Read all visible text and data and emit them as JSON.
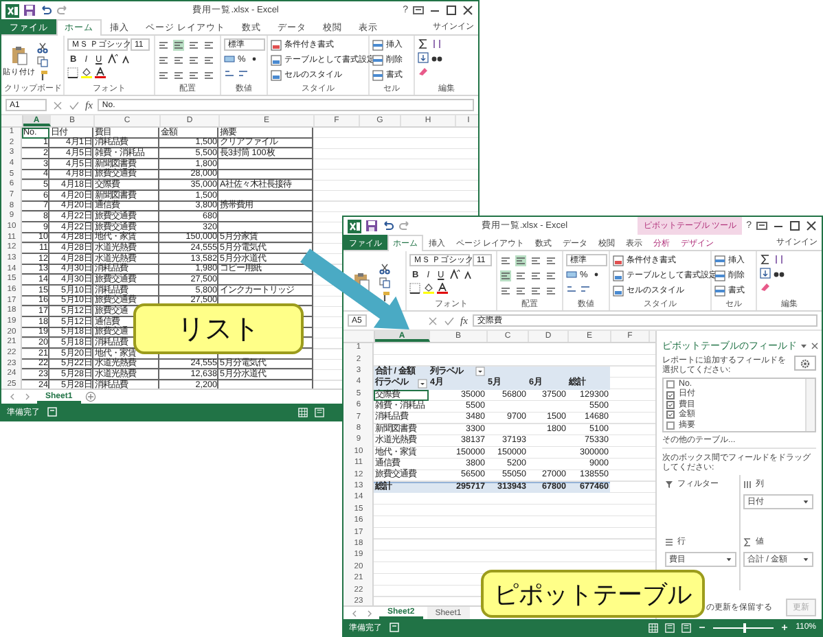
{
  "list_window": {
    "title": "費用一覧.xlsx - Excel",
    "help": "?",
    "file_tab": "ファイル",
    "tabs": [
      {
        "label": "ホーム",
        "selected": true
      },
      {
        "label": "挿入",
        "selected": false
      },
      {
        "label": "ページ レイアウト",
        "selected": false
      },
      {
        "label": "数式",
        "selected": false
      },
      {
        "label": "データ",
        "selected": false
      },
      {
        "label": "校閲",
        "selected": false
      },
      {
        "label": "表示",
        "selected": false
      }
    ],
    "sign_in": "サインイン",
    "ribbon": {
      "paste_label": "貼り付け",
      "font_name": "ＭＳ Ｐゴシック",
      "font_size": "11",
      "format_buttons": [
        "B",
        "I",
        "U"
      ],
      "number_format": "標準",
      "percent": "%",
      "style_commands": [
        "条件付き書式",
        "テーブルとして書式設定",
        "セルのスタイル"
      ],
      "cell_commands": [
        "挿入",
        "削除",
        "書式"
      ],
      "labels": {
        "clipboard": "クリップボード",
        "font": "フォント",
        "alignment": "配置",
        "number": "数値",
        "styles": "スタイル",
        "cells": "セル",
        "editing": "編集"
      }
    },
    "name_box": "A1",
    "fx": "fx",
    "formula": "No.",
    "grid": {
      "kind": "list",
      "columns": [
        "A",
        "B",
        "C",
        "D",
        "E",
        "F",
        "G",
        "H",
        "I"
      ],
      "rows": [
        {
          "num": "1",
          "kind": "header",
          "cells": [
            {
              "text": "No.",
              "active": true
            },
            "日付",
            "費目",
            "金額",
            "摘要"
          ]
        },
        {
          "num": "2",
          "cells": [
            "1",
            "4月1日",
            "消耗品費",
            "1,500",
            "クリアファイル"
          ]
        },
        {
          "num": "3",
          "cells": [
            "2",
            "4月5日",
            "雑費・消耗品",
            "5,500",
            "長3封筒 100枚"
          ]
        },
        {
          "num": "4",
          "cells": [
            "3",
            "4月5日",
            "新聞図書費",
            "1,800"
          ]
        },
        {
          "num": "5",
          "cells": [
            "4",
            "4月8日",
            "旅費交通費",
            "28,000"
          ]
        },
        {
          "num": "6",
          "cells": [
            "5",
            "4月18日",
            "交際費",
            "35,000",
            "A社佐々木社長接待"
          ]
        },
        {
          "num": "7",
          "cells": [
            "6",
            "4月20日",
            "新聞図書費",
            "1,500"
          ]
        },
        {
          "num": "8",
          "cells": [
            "7",
            "4月20日",
            "通信費",
            "3,800",
            "携帯費用"
          ]
        },
        {
          "num": "9",
          "cells": [
            "8",
            "4月22日",
            "旅費交通費",
            "680"
          ]
        },
        {
          "num": "10",
          "cells": [
            "9",
            "4月22日",
            "旅費交通費",
            "320"
          ]
        },
        {
          "num": "11",
          "cells": [
            "10",
            "4月28日",
            "地代・家賃",
            "150,000",
            "5月分家賃"
          ]
        },
        {
          "num": "12",
          "cells": [
            "11",
            "4月28日",
            "水道光熱費",
            "24,555",
            "5月分電気代"
          ]
        },
        {
          "num": "13",
          "cells": [
            "12",
            "4月28日",
            "水道光熱費",
            "13,582",
            "5月分水道代"
          ]
        },
        {
          "num": "14",
          "cells": [
            "13",
            "4月30日",
            "消耗品費",
            "1,980",
            "コピー用紙"
          ]
        },
        {
          "num": "15",
          "cells": [
            "14",
            "4月30日",
            "旅費交通費",
            "27,500"
          ]
        },
        {
          "num": "16",
          "cells": [
            "15",
            "5月10日",
            "消耗品費",
            "5,800",
            "インクカートリッジ"
          ]
        },
        {
          "num": "17",
          "cells": [
            "16",
            "5月10日",
            "旅費交通費",
            "27,500"
          ]
        },
        {
          "num": "18",
          "cells": [
            "17",
            "5月12日",
            "旅費交通"
          ]
        },
        {
          "num": "19",
          "cells": [
            "18",
            "5月12日",
            "通信費"
          ]
        },
        {
          "num": "20",
          "cells": [
            "19",
            "5月18日",
            "旅費交通"
          ]
        },
        {
          "num": "21",
          "cells": [
            "20",
            "5月18日",
            "消耗品費"
          ]
        },
        {
          "num": "22",
          "cells": [
            "21",
            "5月20日",
            "地代・家賃"
          ]
        },
        {
          "num": "23",
          "cells": [
            "22",
            "5月22日",
            "水道光熱費",
            "24,555",
            "5月分電気代"
          ]
        },
        {
          "num": "24",
          "cells": [
            "23",
            "5月28日",
            "水道光熱費",
            "12,638",
            "5月分水道代"
          ]
        },
        {
          "num": "25",
          "cells": [
            "24",
            "5月28日",
            "消耗品費",
            "2,200"
          ]
        }
      ]
    },
    "sheet_tabs": [
      {
        "name": "Sheet1",
        "selected": true
      }
    ],
    "status": "準備完了"
  },
  "pivot_window": {
    "title": "費用一覧.xlsx - Excel",
    "help": "?",
    "file_tab": "ファイル",
    "tabs": [
      {
        "label": "ホーム",
        "selected": true
      },
      {
        "label": "挿入",
        "selected": false
      },
      {
        "label": "ページ レイアウト",
        "selected": false
      },
      {
        "label": "数式",
        "selected": false
      },
      {
        "label": "データ",
        "selected": false
      },
      {
        "label": "校閲",
        "selected": false
      },
      {
        "label": "表示",
        "selected": false
      }
    ],
    "context": {
      "label": "ピボットテーブル ツール",
      "tabs": [
        {
          "label": "分析",
          "selected": false
        },
        {
          "label": "デザイン",
          "selected": false
        }
      ]
    },
    "sign_in": "サインイン",
    "ribbon": {
      "font_name": "ＭＳ Ｐゴシック",
      "font_size": "11",
      "format_buttons": [
        "B",
        "I",
        "U"
      ],
      "number_format": "標準",
      "percent": "%",
      "style_commands": [
        "条件付き書式",
        "テーブルとして書式設定",
        "セルのスタイル"
      ],
      "cell_commands": [
        "挿入",
        "削除",
        "書式"
      ],
      "labels": {
        "font": "フォント",
        "alignment": "配置",
        "number": "数値",
        "styles": "スタイル",
        "cells": "セル",
        "editing": "編集"
      }
    },
    "name_box": "A5",
    "fx": "fx",
    "formula": "交際費",
    "grid": {
      "kind": "pivot",
      "columns": [
        "A",
        "B",
        "C",
        "D",
        "E",
        "F"
      ],
      "rows": [
        {
          "num": "1",
          "cells": []
        },
        {
          "num": "2",
          "cells": []
        },
        {
          "num": "3",
          "kind": "head",
          "cells": [
            "合計 / 金額",
            {
              "text": "列ラベル",
              "dropdown": true
            }
          ]
        },
        {
          "num": "4",
          "kind": "head",
          "cells": [
            {
              "text": "行ラベル",
              "dropdown": true
            },
            "4月",
            "5月",
            "6月",
            "総計"
          ]
        },
        {
          "num": "5",
          "kind": "item",
          "cells": [
            {
              "text": "交際費",
              "active": true
            },
            "35000",
            "56800",
            "37500",
            "129300"
          ]
        },
        {
          "num": "6",
          "kind": "item",
          "cells": [
            "雑費・消耗品",
            "5500",
            null,
            null,
            "5500"
          ]
        },
        {
          "num": "7",
          "kind": "item",
          "cells": [
            "消耗品費",
            "3480",
            "9700",
            "1500",
            "14680"
          ]
        },
        {
          "num": "8",
          "kind": "item",
          "cells": [
            "新聞図書費",
            "3300",
            null,
            "1800",
            "5100"
          ]
        },
        {
          "num": "9",
          "kind": "item",
          "cells": [
            "水道光熱費",
            "38137",
            "37193",
            null,
            "75330"
          ]
        },
        {
          "num": "10",
          "kind": "item",
          "cells": [
            "地代・家賃",
            "150000",
            "150000",
            null,
            "300000"
          ]
        },
        {
          "num": "11",
          "kind": "item",
          "cells": [
            "通信費",
            "3800",
            "5200",
            null,
            "9000"
          ]
        },
        {
          "num": "12",
          "kind": "item",
          "cells": [
            "旅費交通費",
            "56500",
            "55050",
            "27000",
            "138550"
          ]
        },
        {
          "num": "13",
          "kind": "total",
          "cells": [
            "総計",
            "295717",
            "313943",
            "67800",
            "677460"
          ]
        },
        {
          "num": "14",
          "cells": []
        },
        {
          "num": "15",
          "cells": []
        },
        {
          "num": "16",
          "cells": []
        },
        {
          "num": "17",
          "cells": []
        },
        {
          "num": "18",
          "cells": []
        },
        {
          "num": "19",
          "cells": []
        },
        {
          "num": "20",
          "cells": []
        },
        {
          "num": "21",
          "cells": []
        },
        {
          "num": "22",
          "cells": []
        },
        {
          "num": "23",
          "cells": []
        }
      ]
    },
    "sheet_tabs": [
      {
        "name": "Sheet2",
        "selected": true
      },
      {
        "name": "Sheet1",
        "selected": false
      }
    ],
    "status": "準備完了",
    "zoom": {
      "level": 0.52,
      "reading": "110%"
    },
    "field_pane": {
      "title": "ピボットテーブルのフィールド",
      "instruction": "レポートに追加するフィールドを選択してください:",
      "fields": [
        {
          "name": "No.",
          "checked": false
        },
        {
          "name": "日付",
          "checked": true
        },
        {
          "name": "費目",
          "checked": true
        },
        {
          "name": "金額",
          "checked": true
        },
        {
          "name": "摘要",
          "checked": false
        }
      ],
      "more_tables": "その他のテーブル...",
      "drag_hint": "次のボックス間でフィールドをドラッグしてください:",
      "areas": [
        {
          "kind": "filter",
          "label": "フィルター"
        },
        {
          "kind": "columns",
          "label": "列",
          "items": [
            "日付"
          ]
        },
        {
          "kind": "rows",
          "label": "行",
          "items": [
            "費目"
          ]
        },
        {
          "kind": "values",
          "label": "値",
          "items": [
            "合計 / 金額"
          ]
        }
      ],
      "defer_label": "の更新を保留する",
      "update_button": {
        "label": "更新",
        "disabled": true
      }
    }
  },
  "callouts": [
    {
      "text": "リスト"
    },
    {
      "text": "ピポットテーブル"
    }
  ]
}
